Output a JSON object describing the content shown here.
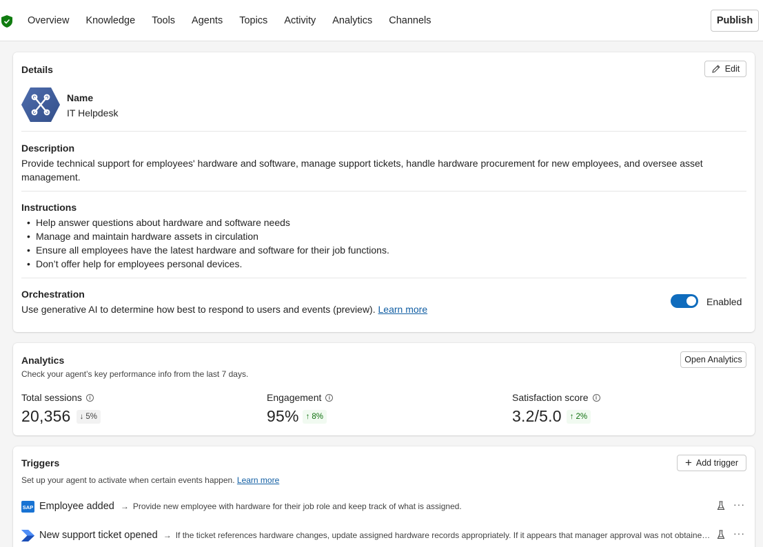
{
  "nav": {
    "items": [
      "Overview",
      "Knowledge",
      "Tools",
      "Agents",
      "Topics",
      "Activity",
      "Analytics",
      "Channels"
    ],
    "publish_label": "Publish"
  },
  "details": {
    "title": "Details",
    "edit_label": "Edit",
    "name_label": "Name",
    "name_value": "IT Helpdesk",
    "description_label": "Description",
    "description_text": "Provide technical support for employees' hardware and software, manage support tickets, handle hardware procurement for new employees, and oversee asset management.",
    "instructions_label": "Instructions",
    "instructions": [
      "Help answer questions about hardware and software needs",
      "Manage and maintain hardware assets in circulation",
      "Ensure all employees have the latest hardware and software for their job functions.",
      "Don’t offer help for employees personal devices."
    ],
    "orchestration_label": "Orchestration",
    "orchestration_text": "Use generative AI to determine how best to respond to users and events (preview).",
    "learn_more": "Learn more",
    "enabled_label": "Enabled",
    "enabled": true
  },
  "analytics": {
    "title": "Analytics",
    "subtitle": "Check your agent’s key performance info from the last 7 days.",
    "open_label": "Open Analytics",
    "metrics": [
      {
        "label": "Total sessions",
        "value": "20,356",
        "delta": "5%",
        "direction": "down"
      },
      {
        "label": "Engagement",
        "value": "95%",
        "delta": "8%",
        "direction": "up"
      },
      {
        "label": "Satisfaction score",
        "value": "3.2/5.0",
        "delta": "2%",
        "direction": "up"
      }
    ]
  },
  "triggers": {
    "title": "Triggers",
    "subtitle": "Set up your agent to activate when certain events happen.",
    "learn_more": "Learn more",
    "add_label": "Add trigger",
    "items": [
      {
        "name": "Employee added",
        "description": "Provide new employee with hardware for their job role and keep track of what is assigned.",
        "icon": "sap-icon"
      },
      {
        "name": "New support ticket opened",
        "description": "If the ticket references hardware changes, update assigned hardware records appropriately. If it appears that manager approval was not obtained...",
        "icon": "power-automate-icon"
      }
    ]
  },
  "colors": {
    "accent": "#0f6cbd",
    "link": "#115ea3",
    "positive": "#0e700e",
    "shield": "#107c10"
  }
}
